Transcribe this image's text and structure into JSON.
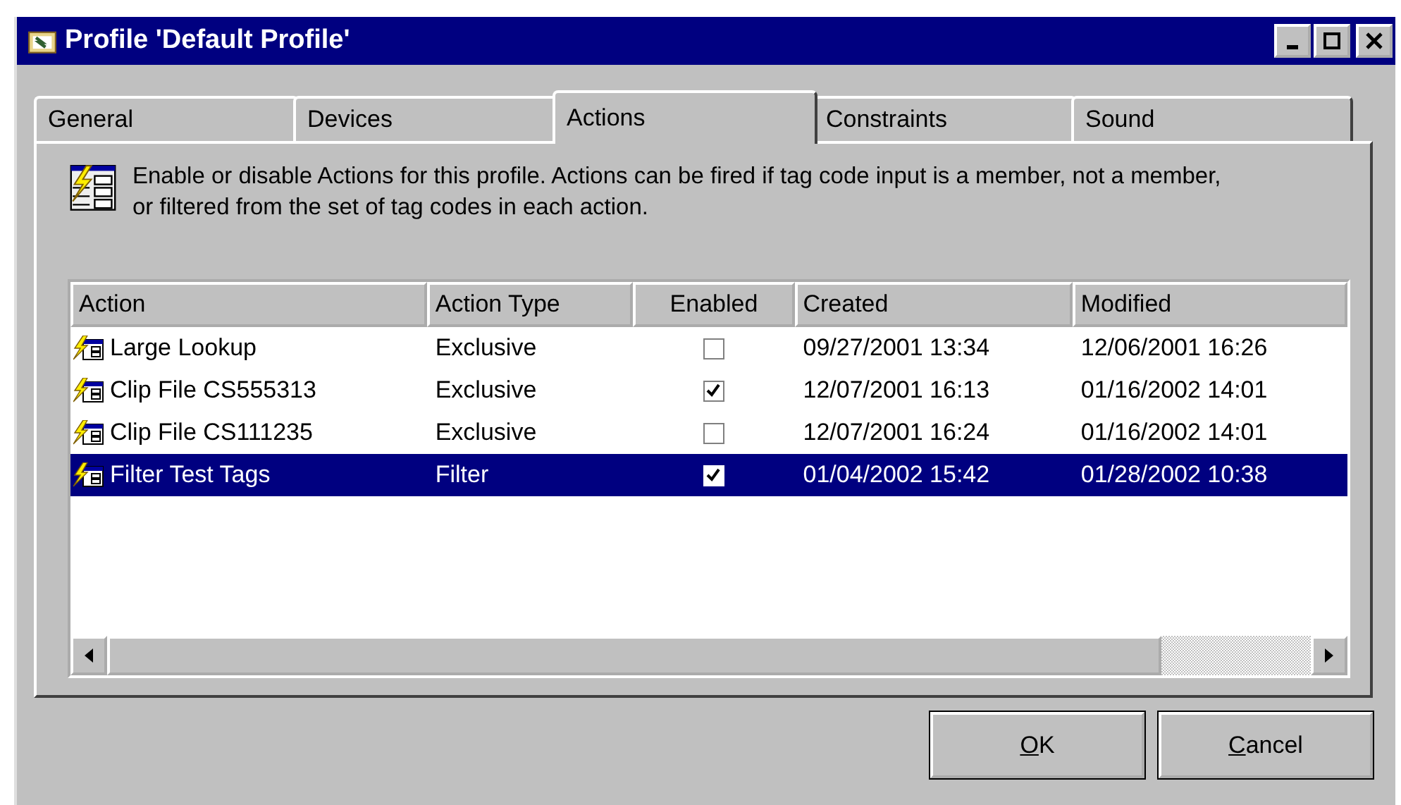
{
  "window": {
    "title": "Profile 'Default Profile'"
  },
  "tabs": [
    {
      "label": "General",
      "selected": false
    },
    {
      "label": "Devices",
      "selected": false
    },
    {
      "label": "Actions",
      "selected": true
    },
    {
      "label": "Constraints",
      "selected": false
    },
    {
      "label": "Sound",
      "selected": false
    }
  ],
  "description": "Enable or disable Actions for this profile. Actions can be fired if tag code input is a member, not a member, or filtered from the set of tag codes in each action.",
  "table": {
    "columns": [
      "Action",
      "Action Type",
      "Enabled",
      "Created",
      "Modified"
    ],
    "rows": [
      {
        "action": "Large Lookup",
        "type": "Exclusive",
        "enabled": false,
        "created": "09/27/2001 13:34",
        "modified": "12/06/2001 16:26",
        "selected": false
      },
      {
        "action": "Clip File CS555313",
        "type": "Exclusive",
        "enabled": true,
        "created": "12/07/2001 16:13",
        "modified": "01/16/2002 14:01",
        "selected": false
      },
      {
        "action": "Clip File CS111235",
        "type": "Exclusive",
        "enabled": false,
        "created": "12/07/2001 16:24",
        "modified": "01/16/2002 14:01",
        "selected": false
      },
      {
        "action": "Filter Test Tags",
        "type": "Filter",
        "enabled": true,
        "created": "01/04/2002 15:42",
        "modified": "01/28/2002 10:38",
        "selected": true
      }
    ]
  },
  "buttons": [
    {
      "access_key": "O",
      "rest": "K"
    },
    {
      "access_key": "C",
      "rest": "ancel"
    }
  ]
}
